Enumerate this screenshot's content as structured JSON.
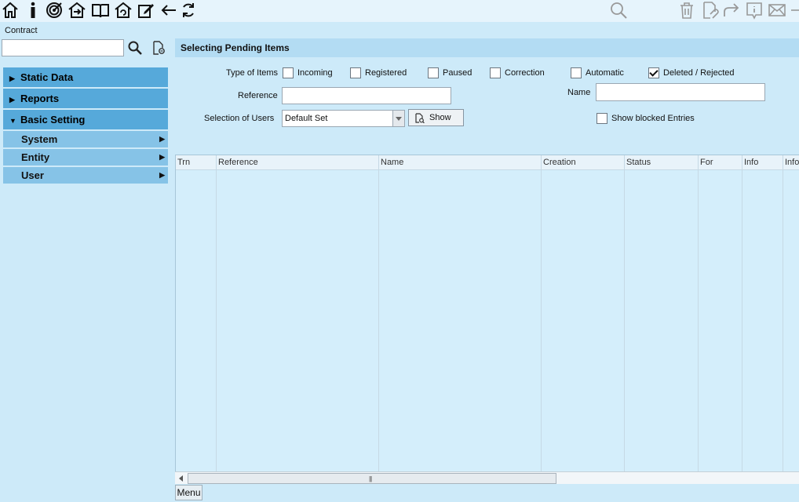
{
  "toolbar": {
    "left_icons": [
      "home-icon",
      "info-icon",
      "target-icon",
      "house-exit-icon",
      "book-icon",
      "house-refresh-icon",
      "edit-icon",
      "back-arrow-icon",
      "refresh-icon"
    ],
    "right_icons": [
      "search-icon",
      "trash-icon",
      "attach-document-icon",
      "forward-icon",
      "info-speech-icon",
      "mail-icon",
      "minimize-icon"
    ]
  },
  "sidebar": {
    "contract_label": "Contract",
    "contract_value": "",
    "items": [
      {
        "label": "Static Data",
        "expanded": false
      },
      {
        "label": "Reports",
        "expanded": false
      },
      {
        "label": "Basic Setting",
        "expanded": true
      }
    ],
    "subitems": [
      {
        "label": "System"
      },
      {
        "label": "Entity"
      },
      {
        "label": "User"
      }
    ]
  },
  "main": {
    "title": "Selecting Pending Items",
    "type_of_items_label": "Type of Items",
    "types": [
      {
        "label": "Incoming",
        "checked": false
      },
      {
        "label": "Registered",
        "checked": false
      },
      {
        "label": "Paused",
        "checked": false
      },
      {
        "label": "Correction",
        "checked": false
      },
      {
        "label": "Automatic",
        "checked": false
      },
      {
        "label": "Deleted / Rejected",
        "checked": true
      }
    ],
    "reference_label": "Reference",
    "reference_value": "",
    "name_label": "Name",
    "name_value": "",
    "selection_of_users_label": "Selection of Users",
    "selection_value": "Default Set",
    "show_button_label": "Show",
    "show_blocked_label": "Show blocked Entries",
    "show_blocked_checked": false
  },
  "table": {
    "columns": [
      "Trn",
      "Reference",
      "Name",
      "Creation",
      "Status",
      "For",
      "Info",
      "Info"
    ],
    "rows": []
  },
  "footer": {
    "menu_label": "Menu"
  }
}
